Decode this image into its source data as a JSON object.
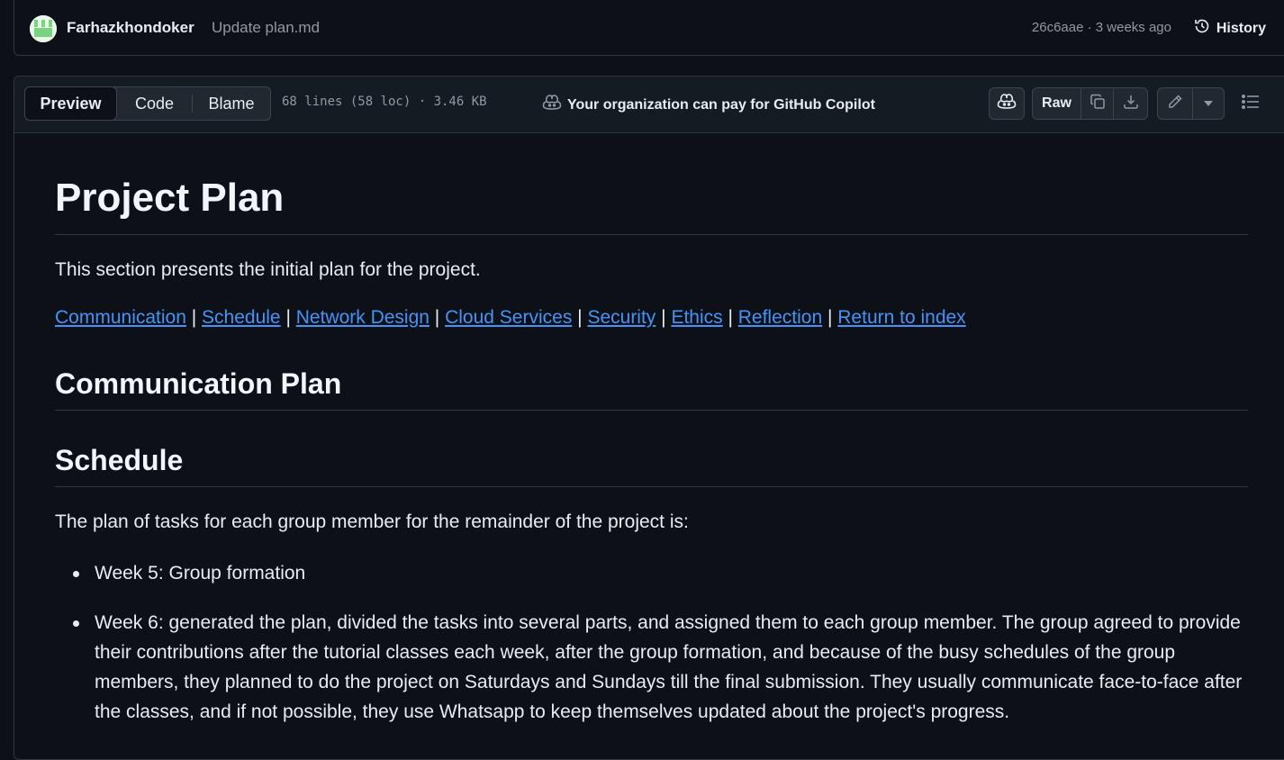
{
  "commit": {
    "author": "Farhazkhondoker",
    "message": "Update plan.md",
    "meta": "26c6aae · 3 weeks ago",
    "history_label": "History"
  },
  "toolbar": {
    "tabs": [
      "Preview",
      "Code",
      "Blame"
    ],
    "file_info": "68 lines (58 loc) · 3.46 KB",
    "copilot_promo": "Your organization can pay for GitHub Copilot",
    "raw_label": "Raw"
  },
  "doc": {
    "title": "Project Plan",
    "intro": "This section presents the initial plan for the project.",
    "links": [
      "Communication",
      "Schedule",
      "Network Design",
      "Cloud Services",
      "Security",
      "Ethics",
      "Reflection",
      "Return to index"
    ],
    "h2_communication": "Communication Plan",
    "h2_schedule": "Schedule",
    "schedule_intro": "The plan of tasks for each group member for the remainder of the project is:",
    "items": [
      "Week 5: Group formation",
      "Week 6: generated the plan, divided the tasks into several parts, and assigned them to each group member. The group agreed to provide their contributions after the tutorial classes each week, after the group formation, and because of the busy schedules of the group members, they planned to do the project on Saturdays and Sundays till the final submission. They usually communicate face-to-face after the classes, and if not possible, they use Whatsapp to keep themselves updated about the project's progress."
    ]
  }
}
